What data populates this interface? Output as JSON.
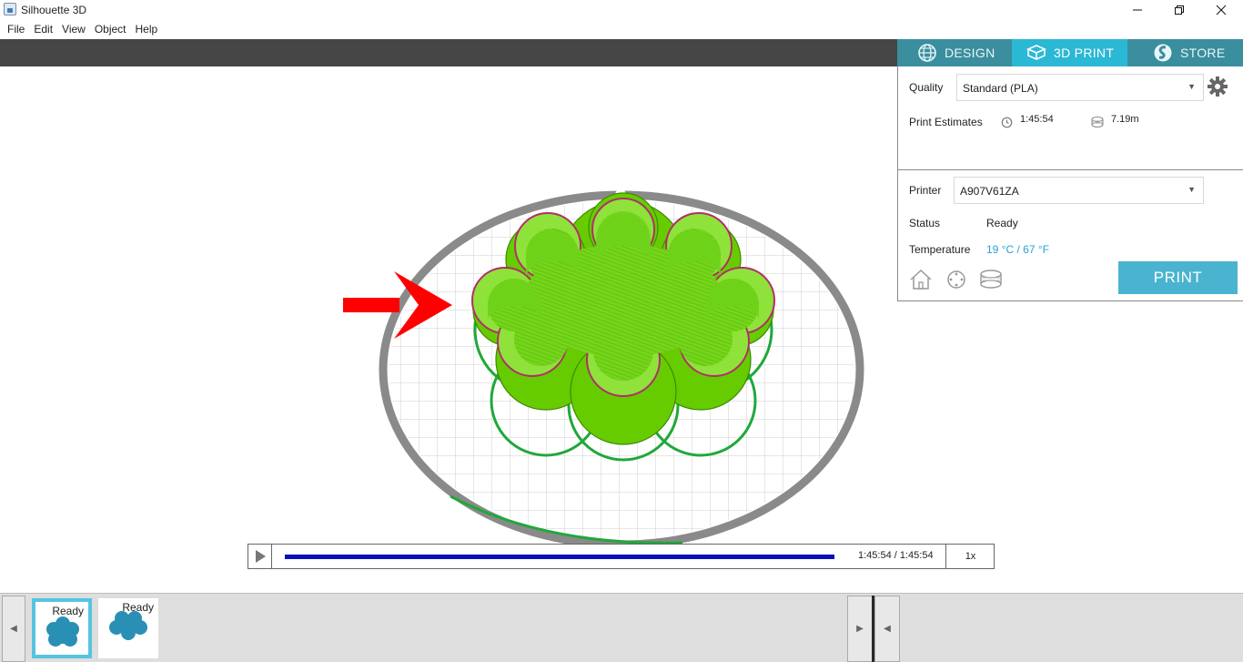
{
  "window": {
    "title": "Silhouette 3D"
  },
  "menu": [
    "File",
    "Edit",
    "View",
    "Object",
    "Help"
  ],
  "modes": {
    "design": "DESIGN",
    "print": "3D PRINT",
    "store": "STORE"
  },
  "settings": {
    "quality_label": "Quality",
    "quality_value": "Standard (PLA)",
    "estimates_label": "Print Estimates",
    "estimate_time": "1:45:54",
    "estimate_filament": "7.19m",
    "printer_label": "Printer",
    "printer_value": "A907V61ZA",
    "status_label": "Status",
    "status_value": "Ready",
    "temperature_label": "Temperature",
    "temperature_value": "19 °C / 67 °F",
    "print_button": "PRINT"
  },
  "colors": {
    "accent": "#2bb8d4",
    "mode_inactive": "#3a8e9e",
    "temperature_text": "#2a9fd6",
    "model_green": "#66cc00",
    "progress": "#0a10b8",
    "annotation_arrow": "#ff0000"
  },
  "playback": {
    "progress": 1.0,
    "time": "1:45:54 / 1:45:54",
    "speed": "1x"
  },
  "jobs": [
    {
      "status": "Ready",
      "selected": true
    },
    {
      "status": "Ready",
      "selected": false
    }
  ]
}
